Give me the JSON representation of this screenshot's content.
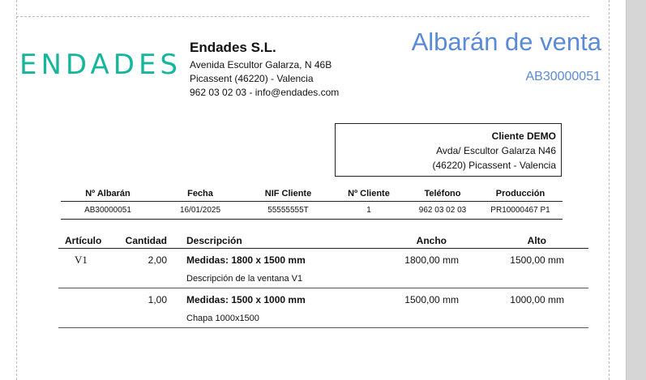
{
  "company": {
    "logo_text": "ENDADES",
    "name": "Endades S.L.",
    "address": "Avenida Escultor Galarza, N 46B",
    "city": "Picassent (46220) - Valencia",
    "contact": "962 03 02 03 - info@endades.com"
  },
  "document": {
    "title": "Albarán de venta",
    "number": "AB30000051"
  },
  "client": {
    "name": "Cliente DEMO",
    "address": "Avda/ Escultor Galarza N46",
    "city": "(46220) Picassent - Valencia"
  },
  "summary": {
    "headers": [
      "Nº Albarán",
      "Fecha",
      "NIF Cliente",
      "Nº Cliente",
      "Teléfono",
      "Producción"
    ],
    "values": [
      "AB30000051",
      "16/01/2025",
      "55555555T",
      "1",
      "962 03 02 03",
      "PR10000467 P1"
    ]
  },
  "lines": {
    "headers": {
      "article": "Artículo",
      "quantity": "Cantidad",
      "description": "Descripción",
      "width": "Ancho",
      "height": "Alto"
    },
    "items": [
      {
        "article": "V1",
        "quantity": "2,00",
        "title": "Medidas: 1800 x 1500 mm",
        "detail": "Descripción de la ventana V1",
        "width": "1800,00 mm",
        "height": "1500,00 mm"
      },
      {
        "article": "",
        "quantity": "1,00",
        "title": "Medidas: 1500 x 1000 mm",
        "detail": "Chapa 1000x1500",
        "width": "1500,00 mm",
        "height": "1000,00 mm"
      }
    ]
  }
}
